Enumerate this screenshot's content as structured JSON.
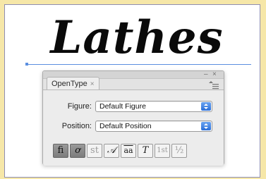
{
  "artwork": {
    "title": "Lathes"
  },
  "panel": {
    "tab_label": "OpenType",
    "tab_close": "×",
    "controls": {
      "minimize": "–",
      "close": "×"
    },
    "fields": [
      {
        "label": "Figure:",
        "value": "Default Figure"
      },
      {
        "label": "Position:",
        "value": "Default Position"
      }
    ],
    "features": [
      {
        "glyph": "fi",
        "state": "active"
      },
      {
        "glyph": "ơ",
        "state": "active"
      },
      {
        "glyph": "st",
        "state": "disabled"
      },
      {
        "glyph": "𝒜",
        "state": "enabled"
      },
      {
        "glyph": "aa",
        "state": "enabled"
      },
      {
        "glyph": "T",
        "state": "enabled"
      },
      {
        "glyph": "1st",
        "state": "disabled"
      },
      {
        "glyph": "½",
        "state": "disabled"
      }
    ]
  },
  "colors": {
    "page_background": "#f6e7a8",
    "selection": "#5b8fe0",
    "select_arrow": "#2b6fd8"
  }
}
